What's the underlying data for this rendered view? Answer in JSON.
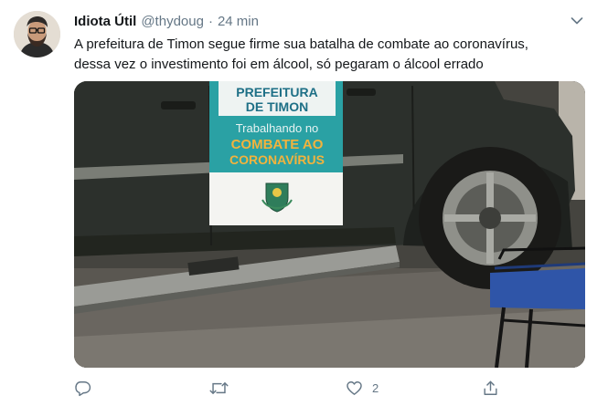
{
  "tweet": {
    "author_name": "Idiota Útil",
    "handle": "@thydoug",
    "separator": "·",
    "time": "24 min",
    "text_line_1": "A prefeitura de Timon segue firme sua batalha de combate ao coronavírus,",
    "text_line_2": "dessa vez o investimento foi em álcool, só pegaram o álcool errado",
    "media": {
      "sign_line_1": "PREFEITURA",
      "sign_line_2": "DE TIMON",
      "sign_line_3": "Trabalhando no",
      "sign_line_4": "COMBATE AO",
      "sign_line_5": "CORONAVÍRUS"
    },
    "actions": {
      "reply_count": "",
      "retweet_count": "",
      "like_count": "2",
      "share_count": ""
    },
    "icons": {
      "caret": "chevron-down-icon",
      "reply": "reply-icon",
      "retweet": "retweet-icon",
      "like": "heart-icon",
      "share": "share-icon"
    },
    "colors": {
      "name": "#14171a",
      "secondary": "#657786",
      "sign_teal": "#2aa1a4",
      "sign_orange": "#f2b33d"
    }
  }
}
